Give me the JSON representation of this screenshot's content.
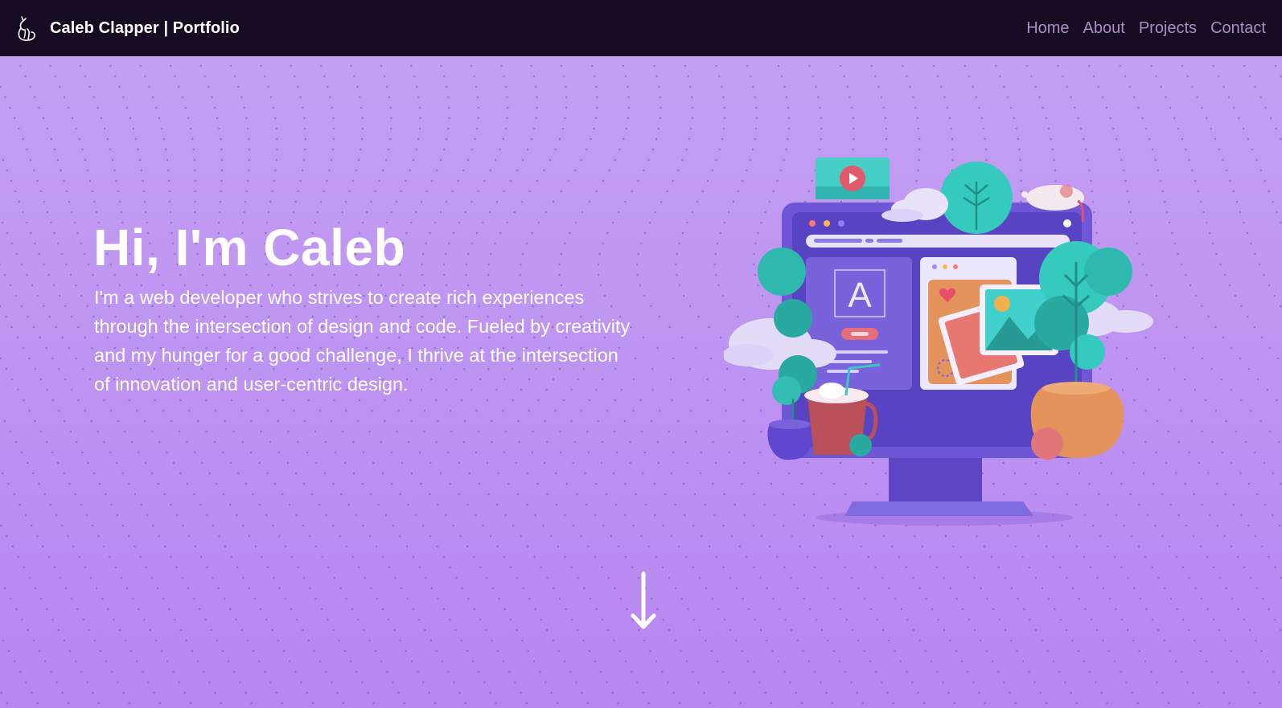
{
  "nav": {
    "logo_icon": "cat-icon",
    "brand": "Caleb Clapper | Portfolio",
    "links": [
      {
        "label": "Home"
      },
      {
        "label": "About"
      },
      {
        "label": "Projects"
      },
      {
        "label": "Contact"
      }
    ]
  },
  "hero": {
    "title": "Hi, I'm Caleb",
    "description": "I'm a web developer who strives to create rich experiences through the intersection of design and code. Fueled by creativity and my hunger for a good challenge, I thrive at the intersection of innovation and user-centric design.",
    "illustration_icon": "web-design-computer-illustration",
    "illustration_letter": "A",
    "scroll_icon": "arrow-down-icon"
  },
  "colors": {
    "navbar_bg": "#170b24",
    "nav_link": "#a98fc4",
    "hero_bg": "#bd92f2",
    "accent_purple": "#7b62dd",
    "accent_teal": "#36c9bd",
    "accent_orange": "#e5935c",
    "text": "#ffffff"
  }
}
